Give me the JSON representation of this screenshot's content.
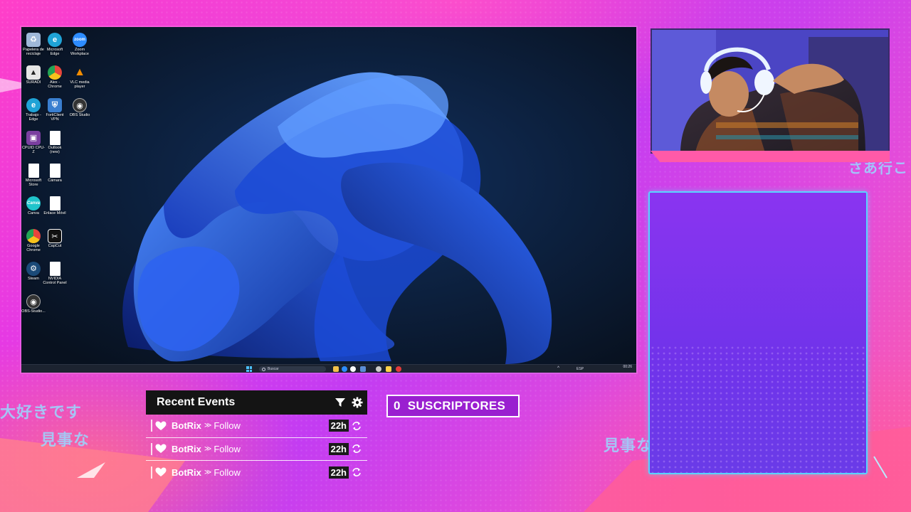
{
  "overlay": {
    "japanese_texts": [
      "大好きです",
      "見事な",
      "見事な",
      "さあ行こ"
    ],
    "colors": {
      "accent": "#58d4ff",
      "panel": "#7a33ee",
      "pink": "#ff4fc0"
    }
  },
  "desktop": {
    "icons": [
      {
        "label": "Papelera de reciclaje",
        "icon": "recycle-bin-icon",
        "color": "#9fb8d8"
      },
      {
        "label": "Microsoft Edge",
        "icon": "edge-icon",
        "color": "#1fa3d6"
      },
      {
        "label": "Zoom Workplace",
        "icon": "zoom-icon",
        "color": "#2d8cff",
        "glyph": "zoom"
      },
      {
        "label": "SURADI",
        "icon": "suradi-icon",
        "color": "#cccccc"
      },
      {
        "label": "Alex - Chrome",
        "icon": "chrome-icon",
        "color": "#e8453c"
      },
      {
        "label": "VLC media player",
        "icon": "vlc-icon",
        "color": "#f28c00"
      },
      {
        "label": "Trabajo - Edge",
        "icon": "edge-icon",
        "color": "#1fa3d6"
      },
      {
        "label": "FortiClient VPN",
        "icon": "forticlient-icon",
        "color": "#3a7fd0"
      },
      {
        "label": "OBS Studio",
        "icon": "obs-icon",
        "color": "#333333"
      },
      {
        "label": "CPUID CPU-Z",
        "icon": "cpuz-icon",
        "color": "#7b3fa0"
      },
      {
        "label": "Outlook (new)",
        "icon": "file-icon",
        "color": "#ffffff"
      },
      {
        "label": "Microsoft Store",
        "icon": "file-icon",
        "color": "#ffffff"
      },
      {
        "label": "Cámara",
        "icon": "file-icon",
        "color": "#ffffff"
      },
      {
        "label": "Canva",
        "icon": "canva-icon",
        "color": "#20c4cb",
        "glyph": "Canva"
      },
      {
        "label": "Enlace Móvil",
        "icon": "file-icon",
        "color": "#ffffff"
      },
      {
        "label": "Google Chrome",
        "icon": "chrome-icon",
        "color": "#e8453c"
      },
      {
        "label": "CapCut",
        "icon": "capcut-icon",
        "color": "#111111"
      },
      {
        "label": "Steam",
        "icon": "steam-icon",
        "color": "#1b4a78"
      },
      {
        "label": "NVIDIA Control Panel",
        "icon": "file-icon",
        "color": "#ffffff"
      },
      {
        "label": "OBS-Studio...",
        "icon": "obs-icon",
        "color": "#333333"
      }
    ],
    "taskbar": {
      "search_placeholder": "Buscar",
      "language": "ESP",
      "time": "00:26",
      "date": "",
      "tray_chevron": "^"
    }
  },
  "recent_events": {
    "title": "Recent Events",
    "filter_icon": "filter-icon",
    "settings_icon": "gear-icon",
    "items": [
      {
        "user": "BotRix",
        "separator": "≫",
        "action": "Follow",
        "time": "22h"
      },
      {
        "user": "BotRix",
        "separator": "≫",
        "action": "Follow",
        "time": "22h"
      },
      {
        "user": "BotRix",
        "separator": "≫",
        "action": "Follow",
        "time": "22h"
      }
    ]
  },
  "subscribers": {
    "count": "0",
    "label": "SUSCRIPTORES"
  },
  "webcam": {
    "description_icon": "webcam-feed"
  }
}
